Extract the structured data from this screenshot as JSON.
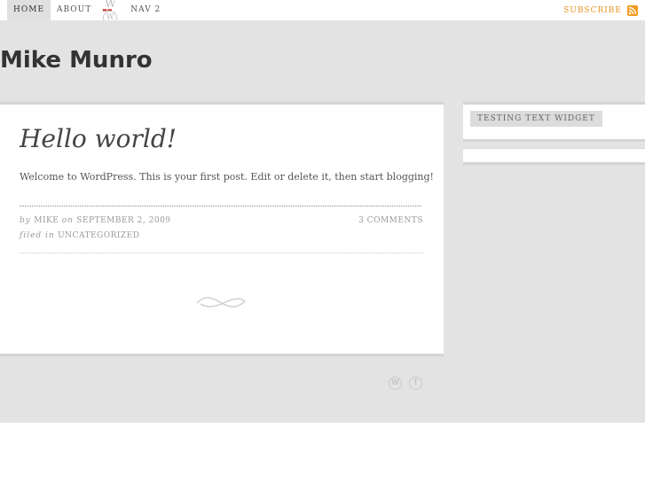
{
  "nav": {
    "items": [
      "HOME",
      "ABOUT",
      "NAV 2"
    ],
    "subscribe_label": "SUBSCRIBE"
  },
  "site": {
    "title": "Mike Munro"
  },
  "post": {
    "title": "Hello world!",
    "body": "Welcome to WordPress. This is your first post. Edit or delete it, then start blogging!",
    "by_label": "by",
    "author": "MIKE",
    "on_label": "on",
    "date": "SEPTEMBER 2, 2009",
    "comments": "3 COMMENTS",
    "filed_label": "filed in",
    "category": "UNCATEGORIZED"
  },
  "sidebar": {
    "widget_title": "TESTING TEXT WIDGET"
  },
  "colors": {
    "accent": "#e6911c",
    "background": "#e3e3e3"
  },
  "icons": [
    "wordpress-logo-icon",
    "rss-icon",
    "wordpress-footer-icon",
    "theme-footer-icon",
    "flourish-icon"
  ]
}
